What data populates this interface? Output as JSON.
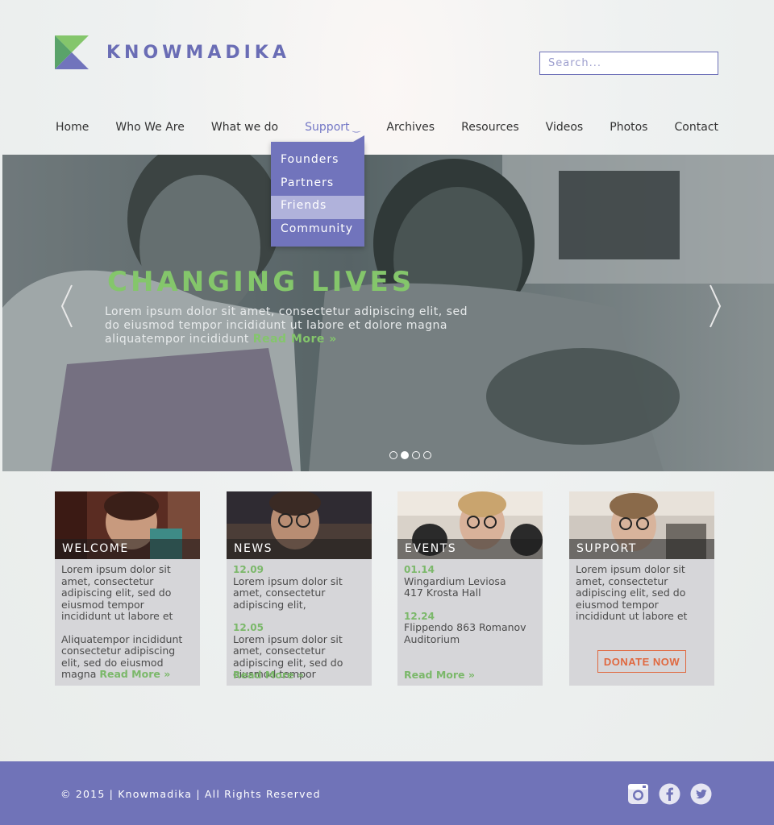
{
  "brand": {
    "name": "KNOWMADIKA",
    "accent": "#6d70b8",
    "green": "#84c66b"
  },
  "search": {
    "placeholder": "Search..."
  },
  "nav": {
    "items": [
      {
        "label": "Home"
      },
      {
        "label": "Who We Are"
      },
      {
        "label": "What we do"
      },
      {
        "label": "Support",
        "active": true,
        "caret": "chevron-down-icon"
      },
      {
        "label": "Archives"
      },
      {
        "label": "Resources"
      },
      {
        "label": "Videos"
      },
      {
        "label": "Photos"
      },
      {
        "label": "Contact"
      }
    ]
  },
  "dropdown": {
    "items": [
      {
        "label": "Founders"
      },
      {
        "label": "Partners"
      },
      {
        "label": "Friends",
        "highlighted": true
      },
      {
        "label": "Community"
      }
    ]
  },
  "hero": {
    "title": "CHANGING LIVES",
    "text": "Lorem ipsum dolor sit amet, consectetur adipiscing elit, sed do eiusmod tempor incididunt ut labore et dolore magna aliquatempor incididunt",
    "read_more": "Read More »",
    "slides": 4,
    "active_slide": 2
  },
  "cards": [
    {
      "label": "WELCOME",
      "paragraphs": [
        "Lorem ipsum dolor sit amet, consectetur adipiscing elit, sed do eiusmod tempor incididunt ut labore et",
        "Aliquatempor incididunt consectetur adipiscing elit, sed do eiusmod magna"
      ],
      "read_more": "Read More »"
    },
    {
      "label": "NEWS",
      "entries": [
        {
          "date": "12.09",
          "text": "Lorem ipsum dolor sit amet, consectetur adipiscing elit,"
        },
        {
          "date": "12.05",
          "text": "Lorem ipsum dolor sit amet, consectetur adipiscing elit, sed do eiusmod tempor"
        }
      ],
      "read_more": "Read More »"
    },
    {
      "label": "EVENTS",
      "entries": [
        {
          "date": "01.14",
          "text": "Wingardium Leviosa 417 Krosta Hall"
        },
        {
          "date": "12.24",
          "text": "Flippendo 863 Romanov Auditorium"
        }
      ],
      "read_more": "Read More »"
    },
    {
      "label": "SUPPORT",
      "paragraphs": [
        "Lorem ipsum dolor sit amet, consectetur adipiscing elit, sed do eiusmod tempor incididunt ut labore et"
      ],
      "button": "DONATE NOW"
    }
  ],
  "footer": {
    "copyright": "© 2015 | Knowmadika | All Rights Reserved",
    "social": [
      "instagram-icon",
      "facebook-icon",
      "twitter-icon"
    ]
  }
}
